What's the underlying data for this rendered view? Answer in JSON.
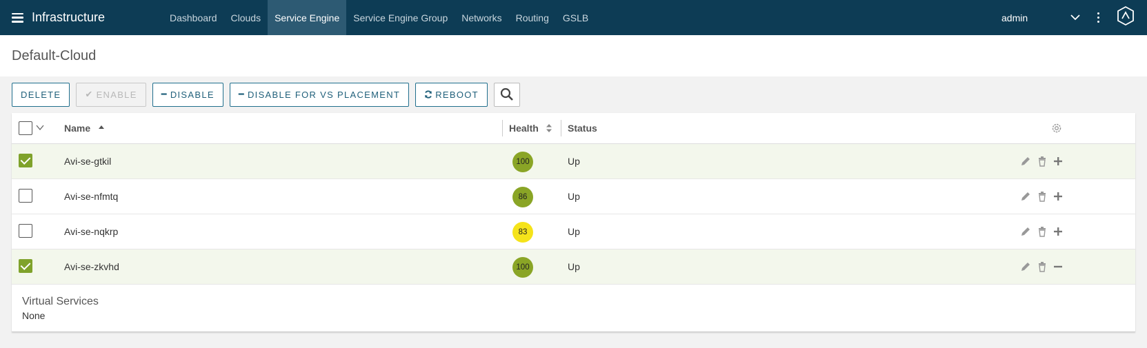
{
  "app": {
    "title": "Infrastructure",
    "user": "admin"
  },
  "nav": {
    "tabs": [
      {
        "label": "Dashboard"
      },
      {
        "label": "Clouds"
      },
      {
        "label": "Service Engine"
      },
      {
        "label": "Service Engine Group"
      },
      {
        "label": "Networks"
      },
      {
        "label": "Routing"
      },
      {
        "label": "GSLB"
      }
    ],
    "active_index": 2
  },
  "page": {
    "title": "Default-Cloud"
  },
  "toolbar": {
    "delete_label": "DELETE",
    "enable_label": "ENABLE",
    "disable_label": "DISABLE",
    "disable_vs_label": "DISABLE FOR VS PLACEMENT",
    "reboot_label": "REBOOT"
  },
  "table": {
    "columns": {
      "name": "Name",
      "health": "Health",
      "status": "Status"
    },
    "rows": [
      {
        "name": "Avi-se-gtkil",
        "health": "100",
        "status": "Up",
        "selected": true,
        "health_color": "#8aa526"
      },
      {
        "name": "Avi-se-nfmtq",
        "health": "86",
        "status": "Up",
        "selected": false,
        "health_color": "#8aa526"
      },
      {
        "name": "Avi-se-nqkrp",
        "health": "83",
        "status": "Up",
        "selected": false,
        "health_color": "#f5e31a"
      },
      {
        "name": "Avi-se-zkvhd",
        "health": "100",
        "status": "Up",
        "selected": true,
        "health_color": "#8aa526"
      }
    ]
  },
  "expanded": {
    "title": "Virtual Services",
    "value": "None"
  },
  "colors": {
    "topbar": "#0d3c55",
    "active_tab": "#2d5a73",
    "accent": "#1f6e8c",
    "check_green": "#7fa22b"
  }
}
